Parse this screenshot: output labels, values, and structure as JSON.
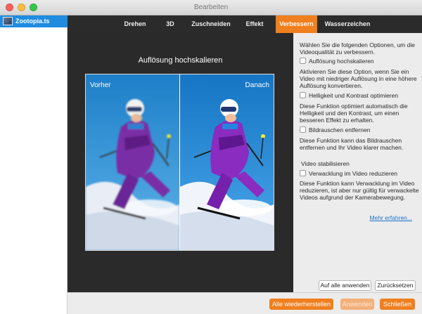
{
  "window": {
    "title": "Bearbeiten"
  },
  "sidebar": {
    "file_name": "Zootopia.ts"
  },
  "tabs": [
    {
      "label": "Drehen"
    },
    {
      "label": "3D"
    },
    {
      "label": "Zuschneiden"
    },
    {
      "label": "Effekt"
    },
    {
      "label": "Verbessern"
    },
    {
      "label": "Wasserzeichen"
    }
  ],
  "active_tab": "Verbessern",
  "preview": {
    "title": "Auflösung hochskalieren",
    "before_label": "Vorher",
    "after_label": "Danach"
  },
  "panel": {
    "intro": "Wählen Sie die folgenden Optionen, um die Videoqualität zu verbessern.",
    "options": [
      {
        "label": "Auflösung hochskalieren",
        "checked": false,
        "description": "Aktivieren Sie diese Option, wenn Sie ein Video mit niedriger Auflösung in eine höhere Auflösung konvertieren."
      },
      {
        "label": "Helligkeit und Kontrast optimieren",
        "checked": false,
        "description": "Diese Funktion optimiert automatisch die Helligkeit und den Kontrast, um einen besseren Effekt zu erhalten."
      },
      {
        "label": "Bildrauschen entfernen",
        "checked": false,
        "description": "Diese Funktion kann das Bildrauschen entfernen und Ihr Video klarer machen."
      }
    ],
    "stabilize_heading": "Video stabilisieren",
    "stabilize_option": {
      "label": "Verwacklung im Video reduzieren",
      "checked": false
    },
    "stabilize_description": "Diese Funktion kann Verwacklung im Video reduzieren, ist aber nur gültig für verwackelte Videos aufgrund der Kamerabewegung.",
    "learn_more": "Mehr erfahren...",
    "apply_all": "Auf alle anwenden",
    "reset": "Zurücksetzen"
  },
  "footer": {
    "restore_all": "Alle wiederherstellen",
    "apply": "Anwenden",
    "close": "Schließen"
  },
  "colors": {
    "accent": "#f07f1f",
    "selection": "#1f8ce0",
    "link": "#1a73c9"
  }
}
